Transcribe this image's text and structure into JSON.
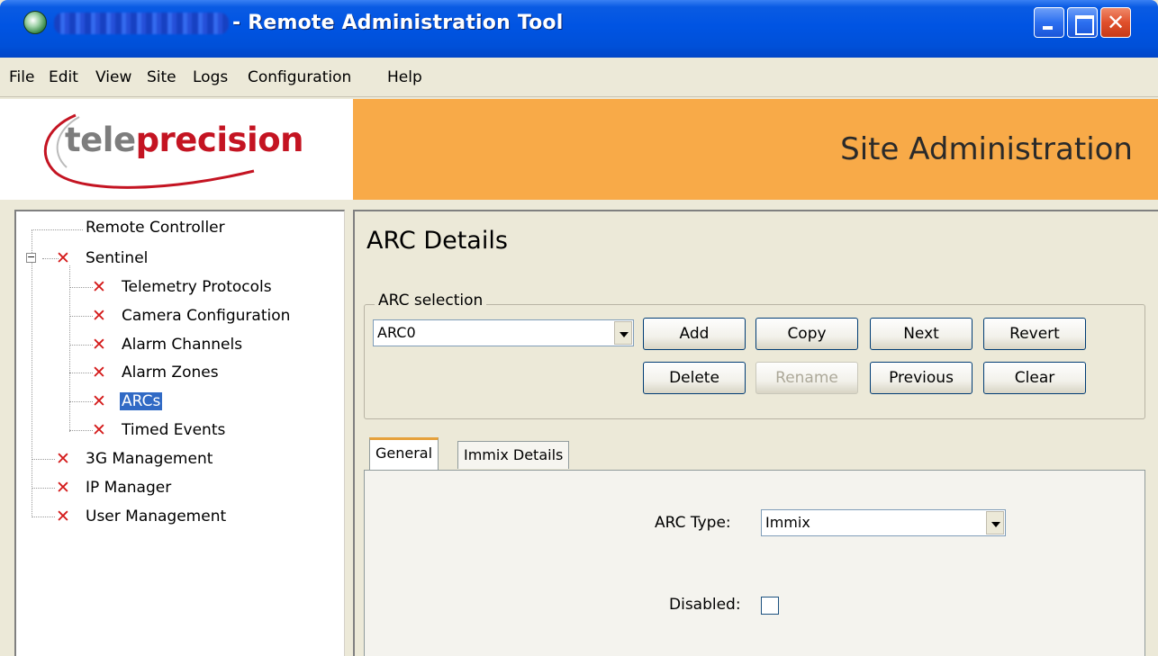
{
  "window": {
    "title_suffix": "- Remote Administration Tool",
    "minimize_icon": "minimize-icon",
    "maximize_icon": "maximize-icon",
    "close_icon": "close-icon"
  },
  "menu": [
    "File",
    "Edit",
    "View",
    "Site",
    "Logs",
    "Configuration",
    "Help"
  ],
  "banner": {
    "logo_prefix": "tele",
    "logo_accent": "precision",
    "section_title": "Site Administration",
    "accent_color": "#F8AA48",
    "logo_red": "#C41422"
  },
  "tree": {
    "remote_controller": "Remote Controller",
    "sentinel": "Sentinel",
    "telemetry_protocols": "Telemetry Protocols",
    "camera_configuration": "Camera Configuration",
    "alarm_channels": "Alarm Channels",
    "alarm_zones": "Alarm Zones",
    "arcs": "ARCs",
    "timed_events": "Timed Events",
    "management_3g": "3G Management",
    "ip_manager": "IP Manager",
    "user_management": "User Management",
    "selected": "ARCs",
    "status_icon": "red-x-icon",
    "expander_symbol": "−"
  },
  "content": {
    "page_title": "ARC Details",
    "arc_selection_label": "ARC selection",
    "arc_selected": "ARC0",
    "buttons": {
      "add": "Add",
      "copy": "Copy",
      "next": "Next",
      "revert": "Revert",
      "delete": "Delete",
      "rename": "Rename",
      "previous": "Previous",
      "clear": "Clear"
    },
    "tabs": {
      "general": "General",
      "immix_details": "Immix Details",
      "active": "General"
    },
    "arc_type_label": "ARC Type:",
    "arc_type_value": "Immix",
    "disabled_label": "Disabled:",
    "disabled_checked": false
  }
}
